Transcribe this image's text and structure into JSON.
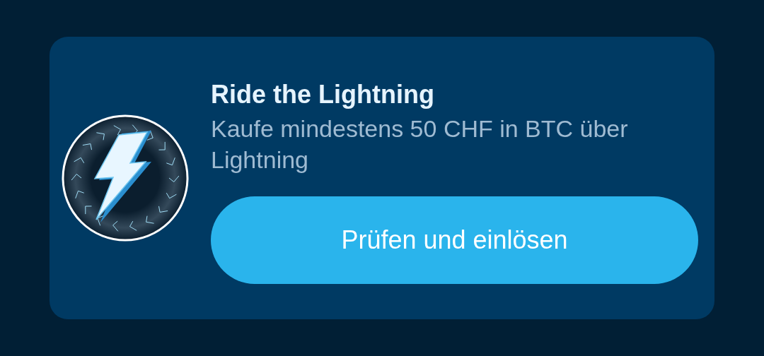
{
  "card": {
    "title": "Ride the Lightning",
    "description": "Kaufe mindestens 50 CHF in BTC über Lightning",
    "button": "Prüfen und einlösen"
  }
}
